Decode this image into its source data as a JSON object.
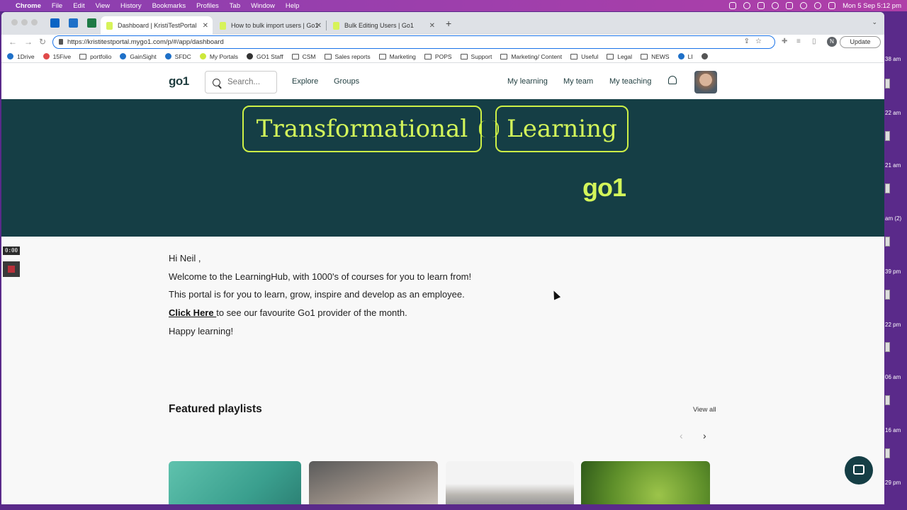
{
  "menubar": {
    "app": "Chrome",
    "items": [
      "File",
      "Edit",
      "View",
      "History",
      "Bookmarks",
      "Profiles",
      "Tab",
      "Window",
      "Help"
    ],
    "clock": "Mon 5 Sep  5:12 pm"
  },
  "tabs": [
    {
      "title": "Dashboard | KristiTestPortal",
      "active": true
    },
    {
      "title": "How to bulk import users | Go1",
      "active": false
    },
    {
      "title": "Bulk Editing Users | Go1",
      "active": false
    }
  ],
  "address": {
    "url": "https://kristitestportal.mygo1.com/p/#/app/dashboard"
  },
  "toolbar": {
    "profile_initial": "N",
    "update_label": "Update"
  },
  "bookmarks": [
    "1Drive",
    "15Five",
    "portfolio",
    "GainSight",
    "SFDC",
    "My Portals",
    "GO1 Staff",
    "CSM",
    "Sales reports",
    "Marketing",
    "POPS",
    "Support",
    "Marketing/ Content",
    "Useful",
    "Legal",
    "NEWS",
    "LI"
  ],
  "site": {
    "logo": "go1",
    "search_placeholder": "Search...",
    "nav_left": [
      "Explore",
      "Groups"
    ],
    "nav_right": [
      "My learning",
      "My team",
      "My teaching"
    ]
  },
  "banner": {
    "word1": "Transformational",
    "word2": "Learning",
    "logo": "go1"
  },
  "video": {
    "time": "0:00"
  },
  "welcome": {
    "greeting": "Hi Neil ,",
    "line1": "Welcome to the LearningHub, with 1000's of courses for you to learn from!",
    "line2": "This portal is for you to learn, grow, inspire and develop as an employee.",
    "link": "Click Here ",
    "line3_rest": "to see our favourite Go1 provider of the month.",
    "line4": "Happy learning!"
  },
  "featured": {
    "title": "Featured playlists",
    "view_all": "View all"
  },
  "desktop_labels": [
    "38 am",
    "22 am",
    "21 am",
    "am (2)",
    "39 pm",
    "22 pm",
    "06 am",
    "16 am",
    "29 pm"
  ],
  "colors": {
    "brand_dark": "#153e45",
    "brand_lime": "#d3f55a",
    "accent_blue": "#1a73e8"
  }
}
